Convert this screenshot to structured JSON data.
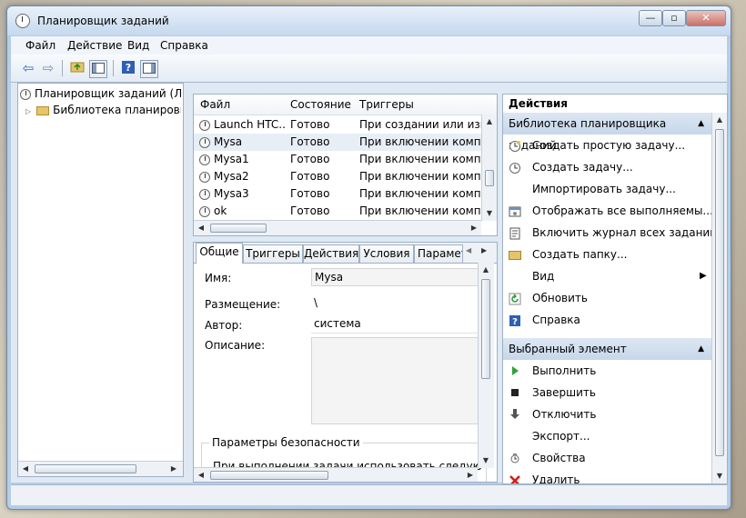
{
  "window": {
    "title": "Планировщик заданий",
    "controls": {
      "minimize": "—",
      "maximize": "▫",
      "close": "✕"
    }
  },
  "menu": [
    "Файл",
    "Действие",
    "Вид",
    "Справка"
  ],
  "toolbar_icons": [
    "back-arrow-icon",
    "forward-arrow-icon",
    "up-folder-icon",
    "show-hide-tree-icon",
    "help-icon",
    "show-hide-action-pane-icon"
  ],
  "tree": {
    "root": "Планировщик заданий (Лок",
    "library": "Библиотека планировщ"
  },
  "task_list": {
    "columns": [
      "Файл",
      "Состояние",
      "Триггеры"
    ],
    "rows": [
      {
        "name": "Launch HTC...",
        "state": "Готово",
        "trigger": "При создании или изме"
      },
      {
        "name": "Mysa",
        "state": "Готово",
        "trigger": "При включении компь"
      },
      {
        "name": "Mysa1",
        "state": "Готово",
        "trigger": "При включении компь"
      },
      {
        "name": "Mysa2",
        "state": "Готово",
        "trigger": "При включении компь"
      },
      {
        "name": "Mysa3",
        "state": "Готово",
        "trigger": "При включении компь"
      },
      {
        "name": "ok",
        "state": "Готово",
        "trigger": "При включении компь"
      }
    ],
    "selected_index": 1
  },
  "detail": {
    "tabs": [
      "Общие",
      "Триггеры",
      "Действия",
      "Условия",
      "Парамет"
    ],
    "active_tab": 0,
    "fields": {
      "name_label": "Имя:",
      "name_value": "Mysa",
      "location_label": "Размещение:",
      "location_value": "\\",
      "author_label": "Автор:",
      "author_value": "система",
      "description_label": "Описание:",
      "description_value": ""
    },
    "security_group": "Параметры безопасности",
    "security_text": "При выполнении задачи использовать следующую у"
  },
  "actions": {
    "title": "Действия",
    "section1": "Библиотека планировщика заданий",
    "items1": [
      {
        "label": "Создать простую задачу...",
        "icon": "create-basic-task-icon"
      },
      {
        "label": "Создать задачу...",
        "icon": "create-task-icon"
      },
      {
        "label": "Импортировать задачу...",
        "icon": ""
      },
      {
        "label": "Отображать все выполняемы...",
        "icon": "running-tasks-icon"
      },
      {
        "label": "Включить журнал всех заданий",
        "icon": "history-log-icon"
      },
      {
        "label": "Создать папку...",
        "icon": "new-folder-icon"
      },
      {
        "label": "Вид",
        "icon": ""
      },
      {
        "label": "Обновить",
        "icon": "refresh-icon"
      },
      {
        "label": "Справка",
        "icon": "help-icon"
      }
    ],
    "section2": "Выбранный элемент",
    "items2": [
      {
        "label": "Выполнить",
        "icon": "run-icon"
      },
      {
        "label": "Завершить",
        "icon": "stop-icon"
      },
      {
        "label": "Отключить",
        "icon": "disable-icon"
      },
      {
        "label": "Экспорт...",
        "icon": ""
      },
      {
        "label": "Свойства",
        "icon": "properties-icon"
      },
      {
        "label": "Удалить",
        "icon": "delete-icon"
      }
    ]
  }
}
